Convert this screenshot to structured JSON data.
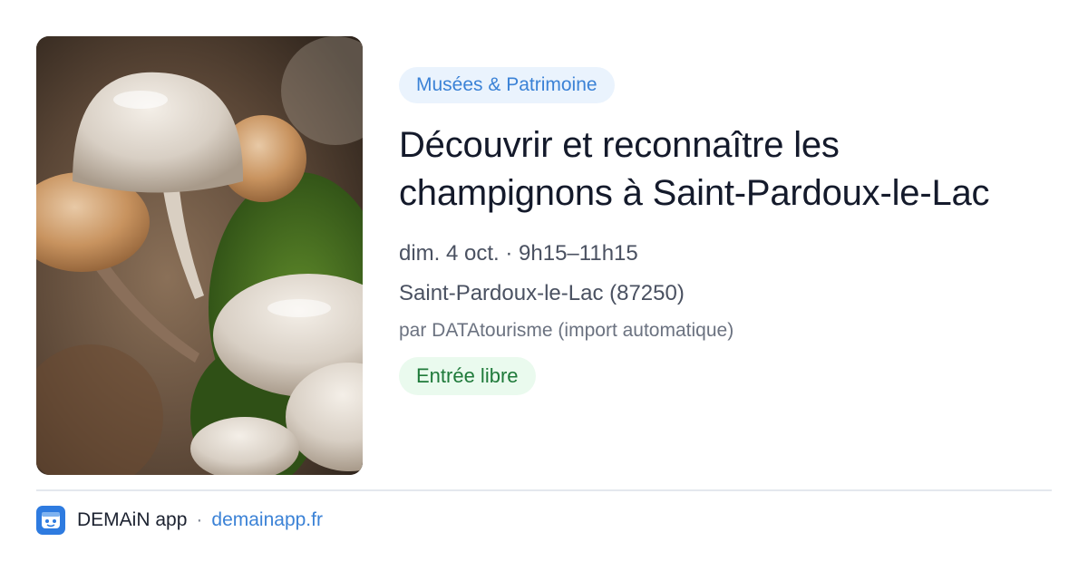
{
  "event": {
    "category": "Musées & Patrimoine",
    "title": "Découvrir et reconnaître les champignons à Saint-Pardoux-le-Lac",
    "when": "dim. 4 oct. · 9h15–11h15",
    "where": "Saint-Pardoux-le-Lac (87250)",
    "source": "par DATAtourisme (import automatique)",
    "price": "Entrée libre"
  },
  "footer": {
    "app_name": "DEMAiN app",
    "separator": "·",
    "site": "demainapp.fr"
  },
  "colors": {
    "category_bg": "#eaf3fd",
    "category_text": "#3b82d6",
    "price_bg": "#eafaee",
    "price_text": "#1f7a3a",
    "brand": "#2e7be0"
  },
  "icons": {
    "app_logo": "demain-logo-icon"
  }
}
